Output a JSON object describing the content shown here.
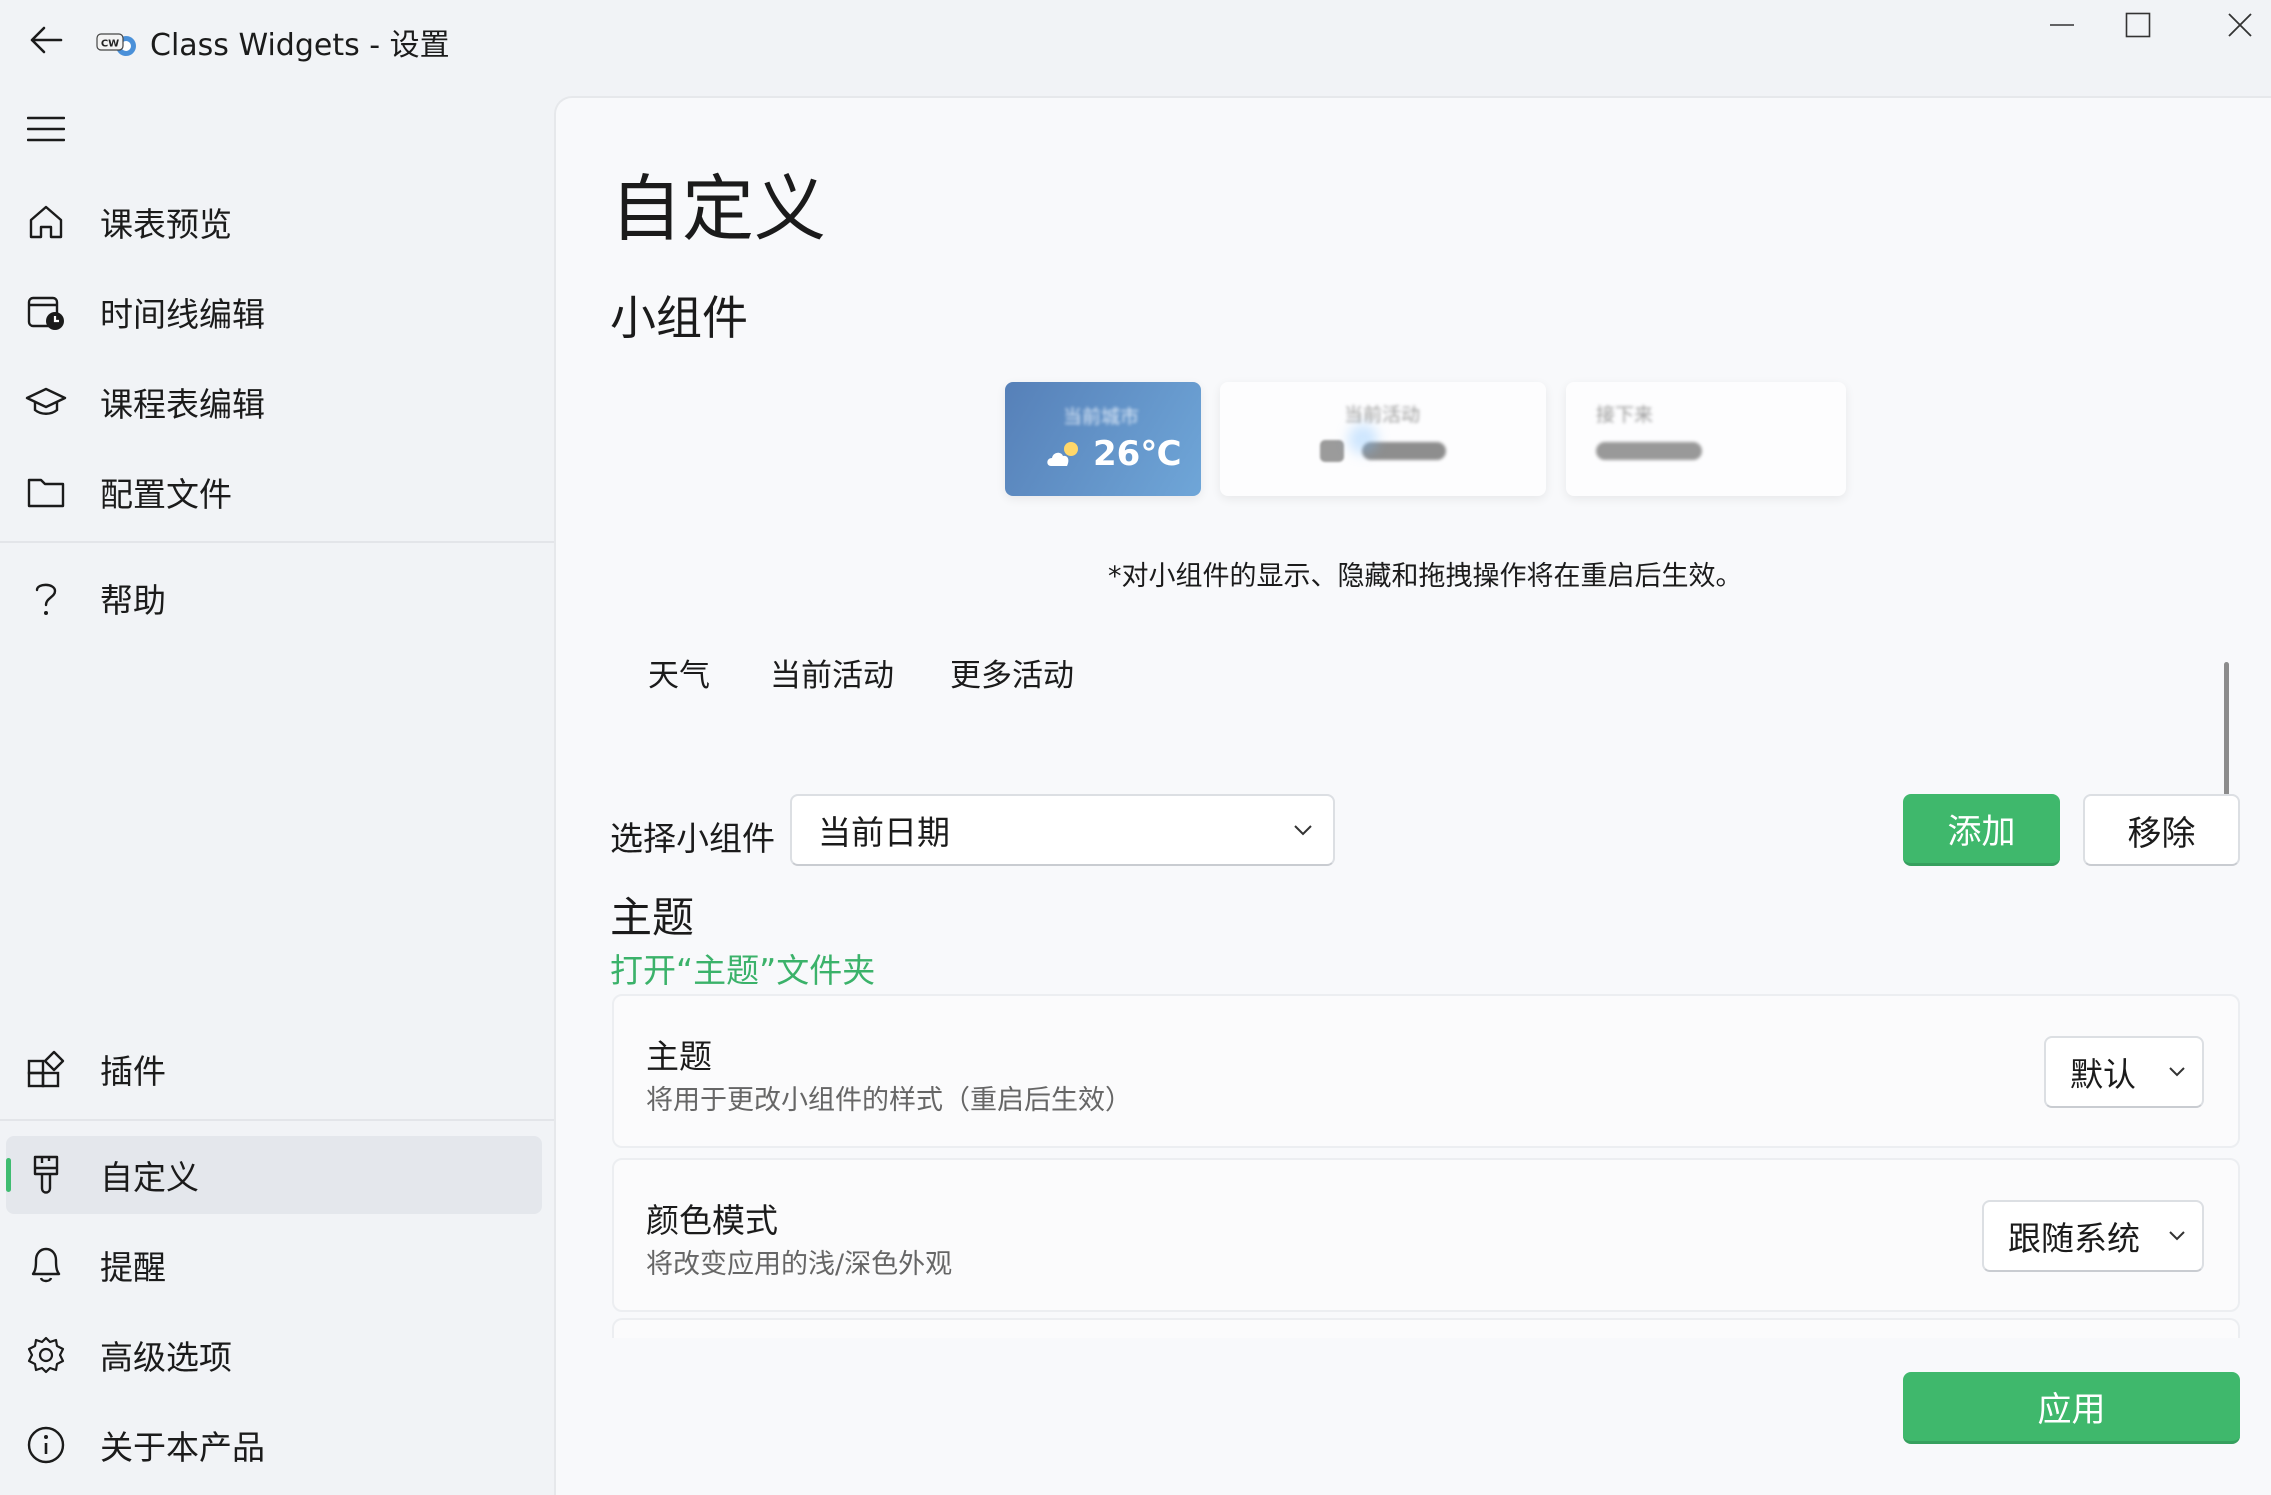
{
  "window": {
    "app_logo_text": "CW",
    "title": "Class Widgets - 设置",
    "controls": [
      "minimize",
      "maximize",
      "close"
    ]
  },
  "sidebar": {
    "top_items": [
      {
        "label": "课表预览",
        "icon": "home-icon"
      },
      {
        "label": "时间线编辑",
        "icon": "calendar-clock-icon"
      },
      {
        "label": "课程表编辑",
        "icon": "graduation-cap-icon"
      },
      {
        "label": "配置文件",
        "icon": "folder-icon"
      },
      {
        "label": "帮助",
        "icon": "question-icon"
      }
    ],
    "bottom_items": [
      {
        "label": "插件",
        "icon": "apps-add-icon"
      },
      {
        "label": "自定义",
        "icon": "paint-brush-icon",
        "active": true
      },
      {
        "label": "提醒",
        "icon": "bell-icon"
      },
      {
        "label": "高级选项",
        "icon": "gear-icon"
      },
      {
        "label": "关于本产品",
        "icon": "info-icon"
      }
    ]
  },
  "page": {
    "title": "自定义",
    "widgets_section": "小组件",
    "preview": {
      "weather_city": "当前城市",
      "weather_temp": "26℃",
      "current_activity": "当前活动",
      "next": "接下来"
    },
    "note": "*对小组件的显示、隐藏和拖拽操作将在重启后生效。",
    "tabs": [
      "天气",
      "当前活动",
      "更多活动"
    ],
    "select_widget": {
      "label": "选择小组件",
      "value": "当前日期",
      "add_label": "添加",
      "remove_label": "移除"
    },
    "theme": {
      "heading": "主题",
      "open_folder_link": "打开“主题”文件夹",
      "settings": [
        {
          "title": "主题",
          "desc": "将用于更改小组件的样式（重启后生效）",
          "value": "默认"
        },
        {
          "title": "颜色模式",
          "desc": "将改变应用的浅/深色外观",
          "value": "跟随系统"
        }
      ]
    },
    "apply_label": "应用"
  },
  "colors": {
    "accent": "#3fb86c",
    "link": "#3bb26a",
    "active_nav_bg": "#e4e7ec"
  }
}
